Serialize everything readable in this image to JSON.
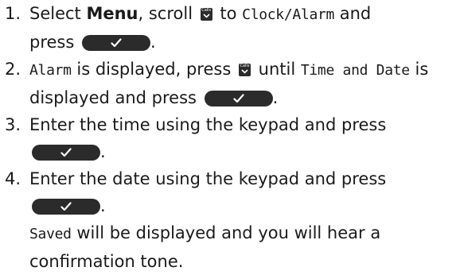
{
  "steps": [
    {
      "number": "1.",
      "parts": {
        "a": "Select ",
        "menu": "Menu",
        "b": ", scroll ",
        "c": " to ",
        "lcd1": "Clock/Alarm",
        "d": " and",
        "e": "press ",
        "f": "."
      }
    },
    {
      "number": "2.",
      "parts": {
        "lcd1": "Alarm",
        "a": " is displayed, press ",
        "b": " until ",
        "lcd2": "Time and Date",
        "c": " is",
        "d": "displayed and press ",
        "e": "."
      }
    },
    {
      "number": "3.",
      "parts": {
        "a": "Enter the time using the keypad and press ",
        "b": "."
      }
    },
    {
      "number": "4.",
      "parts": {
        "a": "Enter the date using the keypad and press ",
        "b": ".",
        "lcd1": "Saved",
        "c": " will be displayed and you will hear a",
        "d": "confirmation tone."
      }
    }
  ],
  "icons": {
    "scroll_key": "calls-scroll-key-icon",
    "scroll_key_label": "Calls",
    "ok_key": "ok-check-key-icon"
  },
  "colors": {
    "key": "#2b2b2b",
    "text": "#1a1a1a"
  }
}
